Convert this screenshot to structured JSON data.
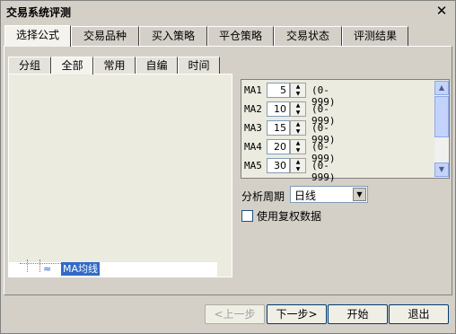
{
  "window": {
    "title": "交易系统评测",
    "close_glyph": "✕"
  },
  "top_tabs": [
    {
      "label": "选择公式"
    },
    {
      "label": "交易品种"
    },
    {
      "label": "买入策略"
    },
    {
      "label": "平仓策略"
    },
    {
      "label": "交易状态"
    },
    {
      "label": "评测结果"
    }
  ],
  "sub_tabs": [
    {
      "label": "分组"
    },
    {
      "label": "全部"
    },
    {
      "label": "常用"
    },
    {
      "label": "自编"
    },
    {
      "label": "时间"
    }
  ],
  "tree": {
    "selected_item": "MA均线"
  },
  "params": [
    {
      "name": "MA1",
      "value": "5",
      "range": "(0-999)"
    },
    {
      "name": "MA2",
      "value": "10",
      "range": "(0-999)"
    },
    {
      "name": "MA3",
      "value": "15",
      "range": "(0-999)"
    },
    {
      "name": "MA4",
      "value": "20",
      "range": "(0-999)"
    },
    {
      "name": "MA5",
      "value": "30",
      "range": "(0-999)"
    }
  ],
  "period": {
    "label": "分析周期",
    "value": "日线"
  },
  "adjusted": {
    "label": "使用复权数据",
    "checked": false
  },
  "buttons": {
    "prev": "<上一步",
    "next": "下一步>",
    "start": "开始",
    "exit": "退出"
  },
  "icons": {
    "close": "close-icon",
    "tree_item": "formula-icon",
    "spin_up": "arrow-up-icon",
    "spin_down": "arrow-down-icon",
    "dropdown": "chevron-down-icon"
  }
}
